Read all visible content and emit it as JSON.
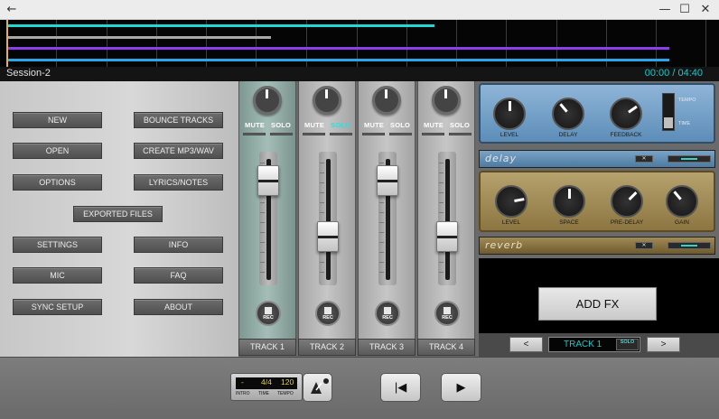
{
  "window": {
    "back_glyph": "←",
    "min_glyph": "—",
    "max_glyph": "☐",
    "close_glyph": "✕"
  },
  "session": {
    "name": "Session-2",
    "time": "00:00 / 04:40"
  },
  "timeline": {
    "colors": {
      "track1": "#1fd8d8",
      "track2": "#a8a8a8",
      "track3": "#8d3df0",
      "track4": "#2aa6e8",
      "playhead": "#e3b05a"
    },
    "track_fraction": [
      0.6,
      0.37,
      0.93,
      0.93
    ]
  },
  "menu": {
    "new": "NEW",
    "bounce": "BOUNCE TRACKS",
    "open": "OPEN",
    "create_mp3": "CREATE MP3/WAV",
    "options": "OPTIONS",
    "lyrics": "LYRICS/NOTES",
    "exported": "EXPORTED FILES",
    "settings": "SETTINGS",
    "info": "INFO",
    "mic": "MIC",
    "faq": "FAQ",
    "sync": "SYNC SETUP",
    "about": "ABOUT"
  },
  "mixer": {
    "mute": "MUTE",
    "solo": "SOLO",
    "rec": "REC",
    "tracks": [
      {
        "label": "TRACK 1",
        "fader_level": 0.87,
        "selected": true,
        "solo_active": false
      },
      {
        "label": "TRACK 2",
        "fader_level": 0.35,
        "selected": false,
        "solo_active": true
      },
      {
        "label": "TRACK 3",
        "fader_level": 0.87,
        "selected": false,
        "solo_active": false
      },
      {
        "label": "TRACK 4",
        "fader_level": 0.35,
        "selected": false,
        "solo_active": false
      }
    ]
  },
  "fx": {
    "delay": {
      "name": "delay",
      "knobs": [
        "LEVEL",
        "DELAY",
        "FEEDBACK"
      ],
      "knob_rotation_deg": [
        0,
        -40,
        55
      ],
      "tempo_label": "TEMPO",
      "time_label": "TIME"
    },
    "reverb": {
      "name": "reverb",
      "knobs": [
        "LEVEL",
        "SPACE",
        "PRE-DELAY",
        "GAIN"
      ],
      "knob_rotation_deg": [
        80,
        0,
        45,
        -40
      ]
    },
    "bypass_glyph": "✕",
    "add_label": "ADD FX",
    "prev": "<",
    "next": ">",
    "current_track": "TRACK 1",
    "solo": "SOLO"
  },
  "transport": {
    "intro": "-",
    "time_sig": "4/4",
    "tempo": "120",
    "intro_label": "INTRO",
    "time_label": "TIME",
    "tempo_label": "TEMPO",
    "skip_back": "|◀",
    "play": "▶"
  }
}
